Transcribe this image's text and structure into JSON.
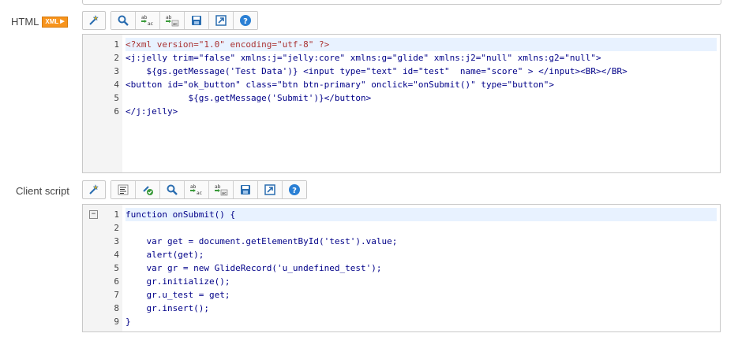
{
  "html_field": {
    "label": "HTML",
    "badge": "XML",
    "toolbar": [
      "wand-icon",
      "search-icon",
      "replace-icon",
      "replace-all-icon",
      "save-icon",
      "fullscreen-icon",
      "help-icon"
    ],
    "lines": [
      {
        "num": "1",
        "text": "<?xml version=\"1.0\" encoding=\"utf-8\" ?>"
      },
      {
        "num": "2",
        "text": "<j:jelly trim=\"false\" xmlns:j=\"jelly:core\" xmlns:g=\"glide\" xmlns:j2=\"null\" xmlns:g2=\"null\">"
      },
      {
        "num": "3",
        "text": "    ${gs.getMessage('Test Data')} <input type=\"text\" id=\"test\"  name=\"score\" > </input><BR></BR>"
      },
      {
        "num": "4",
        "text": "<button id=\"ok_button\" class=\"btn btn-primary\" onclick=\"onSubmit()\" type=\"button\">"
      },
      {
        "num": "5",
        "text": "            ${gs.getMessage('Submit')}</button>"
      },
      {
        "num": "6",
        "text": "</j:jelly>"
      }
    ]
  },
  "client_field": {
    "label": "Client script",
    "toolbar": [
      "format-icon",
      "check-syntax-icon",
      "search-icon",
      "replace-icon",
      "replace-all-icon",
      "save-icon",
      "fullscreen-icon",
      "help-icon"
    ],
    "fold_symbol": "⊟",
    "lines": [
      {
        "num": "1",
        "text": "function onSubmit() {"
      },
      {
        "num": "2",
        "text": ""
      },
      {
        "num": "3",
        "text": "    var get = document.getElementById('test').value;"
      },
      {
        "num": "4",
        "text": "    alert(get);"
      },
      {
        "num": "5",
        "text": "    var gr = new GlideRecord('u_undefined_test');"
      },
      {
        "num": "6",
        "text": "    gr.initialize();"
      },
      {
        "num": "7",
        "text": "    gr.u_test = get;"
      },
      {
        "num": "8",
        "text": "    gr.insert();"
      },
      {
        "num": "9",
        "text": "}"
      }
    ]
  }
}
